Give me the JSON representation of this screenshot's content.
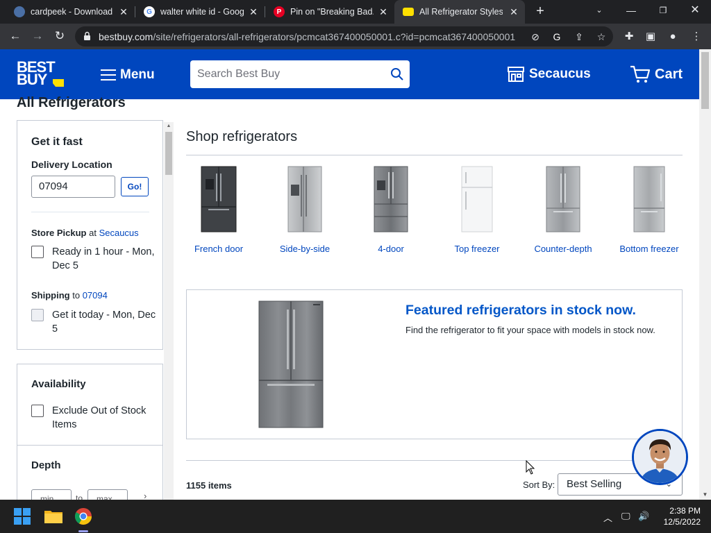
{
  "browser": {
    "tabs": [
      {
        "title": "cardpeek - Download",
        "icon": "cardpeek-icon",
        "active": false
      },
      {
        "title": "walter white id - Googl",
        "icon": "google-icon",
        "active": false
      },
      {
        "title": "Pin on \"Breaking Bad...",
        "icon": "pinterest-icon",
        "active": false
      },
      {
        "title": "All Refrigerator Styles",
        "icon": "bestbuy-tag-icon",
        "active": true
      }
    ],
    "url_host": "bestbuy.com",
    "url_path": "/site/refrigerators/all-refrigerators/pcmcat367400050001.c?id=pcmcat367400050001"
  },
  "header": {
    "logo_line1": "BEST",
    "logo_line2": "BUY",
    "menu_label": "Menu",
    "search_placeholder": "Search Best Buy",
    "store_label": "Secaucus",
    "cart_label": "Cart",
    "brand_color": "#0046be",
    "tag_color": "#ffe000"
  },
  "page": {
    "title": "All Refrigerators"
  },
  "filters": {
    "get_it_fast": "Get it fast",
    "delivery_location": "Delivery Location",
    "zip_value": "07094",
    "go_label": "Go!",
    "store_pickup_label": "Store Pickup",
    "store_pickup_at": "at",
    "store_pickup_store": "Secaucus",
    "pickup_option": "Ready in 1 hour - Mon, Dec 5",
    "shipping_label": "Shipping",
    "shipping_to": "to",
    "shipping_zip": "07094",
    "shipping_option": "Get it today - Mon, Dec 5",
    "availability": "Availability",
    "exclude_oos": "Exclude Out of Stock Items",
    "depth": "Depth",
    "depth_min_placeholder": "min",
    "depth_to": "to",
    "depth_max_placeholder": "max"
  },
  "shop": {
    "heading": "Shop refrigerators",
    "categories": [
      {
        "label": "French door",
        "style": "french-door-dark"
      },
      {
        "label": "Side-by-side",
        "style": "side-by-side"
      },
      {
        "label": "4-door",
        "style": "four-door"
      },
      {
        "label": "Top freezer",
        "style": "top-freezer-white"
      },
      {
        "label": "Counter-depth",
        "style": "counter-depth"
      },
      {
        "label": "Bottom freezer",
        "style": "bottom-freezer"
      }
    ]
  },
  "featured": {
    "title": "Featured refrigerators in stock now.",
    "subtitle": "Find the refrigerator to fit your space with models in stock now."
  },
  "results": {
    "count": "1155 items",
    "sort_label": "Sort By:",
    "sort_value": "Best Selling"
  },
  "taskbar": {
    "time": "2:38 PM",
    "date": "12/5/2022"
  }
}
